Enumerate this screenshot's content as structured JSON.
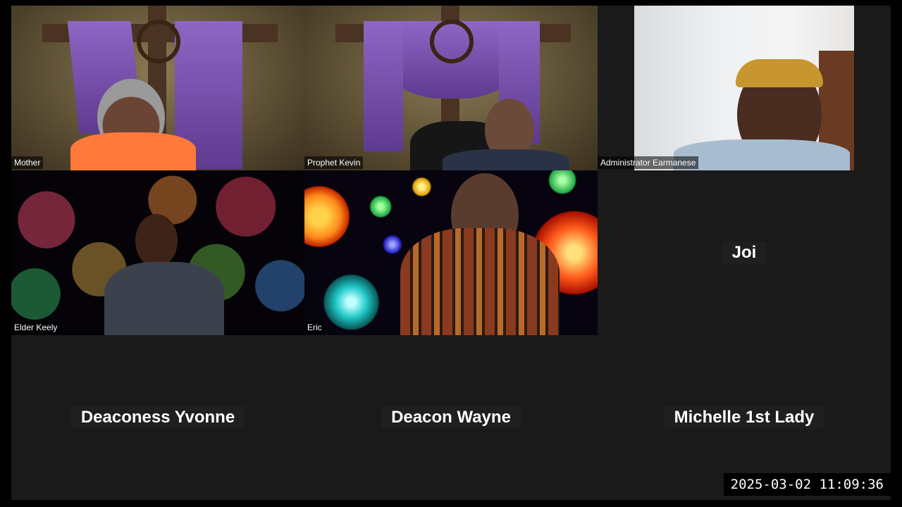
{
  "participants": [
    {
      "name": "Mother",
      "video": true
    },
    {
      "name": "Prophet Kevin",
      "video": true
    },
    {
      "name": "Administrator Earmanese",
      "video": true
    },
    {
      "name": "Elder Keely",
      "video": true
    },
    {
      "name": "Eric",
      "video": true
    },
    {
      "name": "Joi",
      "video": false
    },
    {
      "name": "Deaconess Yvonne",
      "video": false
    },
    {
      "name": "Deacon Wayne",
      "video": false
    },
    {
      "name": "Michelle 1st Lady",
      "video": false
    }
  ],
  "overlay": {
    "timestamp": "2025-03-02 11:09:36"
  },
  "colors": {
    "stage_bg": "#1a1a1a",
    "outer_bg": "#000000",
    "drape_purple": "#7b4fb3",
    "name_text": "#ffffff"
  }
}
